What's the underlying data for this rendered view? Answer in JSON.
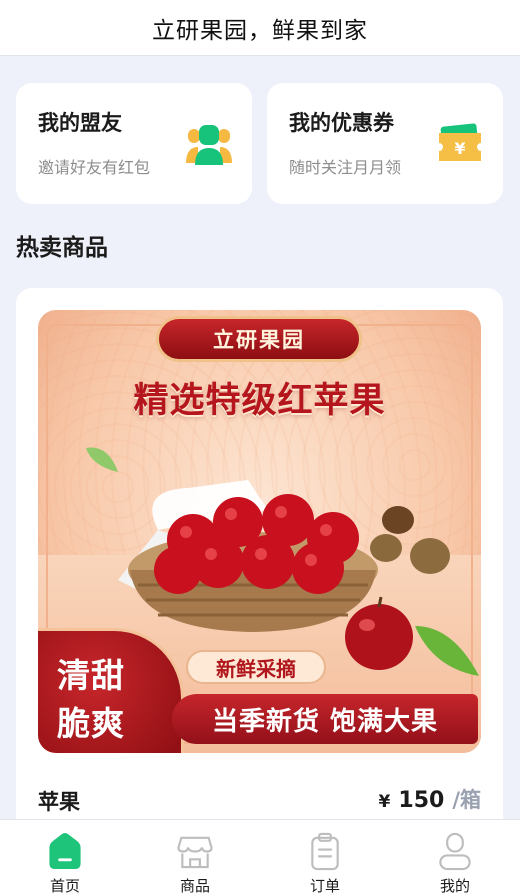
{
  "header": {
    "title": "立研果园，鲜果到家"
  },
  "promos": [
    {
      "title": "我的盟友",
      "subtitle": "邀请好友有红包",
      "icon": "friends-icon"
    },
    {
      "title": "我的优惠券",
      "subtitle": "随时关注月月领",
      "icon": "coupon-icon"
    }
  ],
  "section": {
    "title": "热卖商品"
  },
  "product": {
    "banner": {
      "brand": "立研果园",
      "headline": "精选特级红苹果",
      "corner_line1": "清甜",
      "corner_line2": "脆爽",
      "tag": "新鲜采摘",
      "slogan": "当季新货 饱满大果"
    },
    "name": "苹果",
    "currency": "¥",
    "price": "150",
    "unit": "/箱"
  },
  "tabbar": {
    "active_color": "#1ec47a",
    "inactive_color": "#bdbdbd",
    "items": [
      {
        "label": "首页",
        "icon": "home-icon",
        "active": true
      },
      {
        "label": "商品",
        "icon": "shop-icon",
        "active": false
      },
      {
        "label": "订单",
        "icon": "order-clipboard-icon",
        "active": false
      },
      {
        "label": "我的",
        "icon": "user-icon",
        "active": false
      }
    ]
  }
}
